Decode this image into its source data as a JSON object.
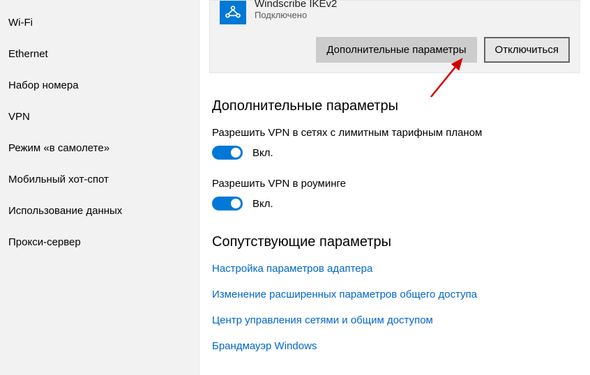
{
  "sidebar": {
    "items": [
      {
        "label": "Wi-Fi"
      },
      {
        "label": "Ethernet"
      },
      {
        "label": "Набор номера"
      },
      {
        "label": "VPN"
      },
      {
        "label": "Режим «в самолете»"
      },
      {
        "label": "Мобильный хот-спот"
      },
      {
        "label": "Использование данных"
      },
      {
        "label": "Прокси-сервер"
      }
    ]
  },
  "vpn": {
    "name": "Windscribe IKEv2",
    "status": "Подключено",
    "advanced_button": "Дополнительные параметры",
    "disconnect_button": "Отключиться"
  },
  "advanced": {
    "heading": "Дополнительные параметры",
    "metered_label": "Разрешить VPN в сетях с лимитным тарифным планом",
    "metered_state": "Вкл.",
    "roaming_label": "Разрешить VPN в роуминге",
    "roaming_state": "Вкл."
  },
  "related": {
    "heading": "Сопутствующие параметры",
    "links": [
      "Настройка параметров адаптера",
      "Изменение расширенных параметров общего доступа",
      "Центр управления сетями и общим доступом",
      "Брандмауэр Windows"
    ]
  },
  "colors": {
    "accent": "#0078d7",
    "link": "#0066cc",
    "sidebar_bg": "#f2f2f2"
  }
}
